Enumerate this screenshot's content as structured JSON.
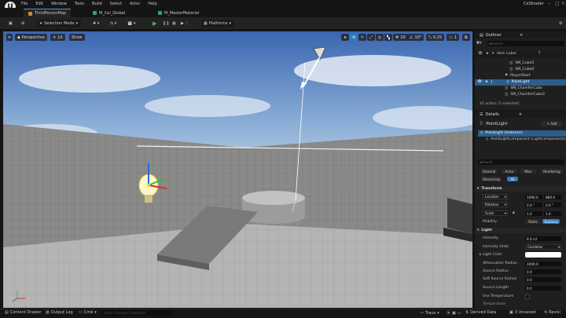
{
  "menu": [
    "File",
    "Edit",
    "Window",
    "Tools",
    "Build",
    "Select",
    "Actor",
    "Help"
  ],
  "project_name": "CelShader",
  "tabs": [
    {
      "label": "ThirdPersonMap",
      "color": "#d08a2a"
    },
    {
      "label": "M_Cel_Global",
      "color": "#3aa35a"
    },
    {
      "label": "M_MasterMaterial",
      "color": "#3aa35a"
    }
  ],
  "toolbar": {
    "mode": "Selection Mode",
    "platforms": "Platforms"
  },
  "viewport": {
    "perspective": "Perspective",
    "lit": "Lit",
    "show": "Show",
    "grid_snap": "10",
    "rot_snap": "10°",
    "scale_snap": "0.25",
    "camera_speed": "1"
  },
  "outliner": {
    "title": "Outliner",
    "search_placeholder": "Search...",
    "col_label": "Item Label",
    "items": [
      {
        "label": "SM_Cube5",
        "selected": false
      },
      {
        "label": "SM_Cube6",
        "selected": false
      },
      {
        "label": "PlayerStart",
        "selected": false
      },
      {
        "label": "PointLight",
        "selected": true
      },
      {
        "label": "SM_ChamferCube",
        "selected": false
      },
      {
        "label": "SM_ChamferCube2",
        "selected": false
      }
    ],
    "status": "42 actors (1 selected)"
  },
  "details": {
    "title": "Details",
    "actor_name": "PointLight",
    "add_label": "+ Add",
    "instance_label": "PointLight (Instance)",
    "component_label": "PointLightComponent (LightComponent0)",
    "search_placeholder": "Search",
    "filters_row1": [
      "General",
      "Actor",
      "Misc",
      "Rendering"
    ],
    "filters_row2": [
      "Streaming",
      "All"
    ],
    "transform_header": "Transform",
    "location_label": "Location",
    "location_x": "1090.0",
    "location_y": "880.0",
    "rotation_label": "Rotation",
    "rotation_x": "0.0 °",
    "rotation_y": "0.0 °",
    "scale_label": "Scale",
    "scale_x": "1.0",
    "scale_y": "1.0",
    "mobility_label": "Mobility",
    "mobility_static": "Static",
    "mobility_stationary": "Stationa",
    "light_header": "Light",
    "intensity_label": "Intensity",
    "intensity_value": "8.0 cd",
    "intensity_units_label": "Intensity Units",
    "intensity_units_value": "Candelas",
    "light_color_label": "Light Color",
    "attenuation_label": "Attenuation Radius",
    "attenuation_value": "1000.0",
    "source_radius_label": "Source Radius",
    "source_radius_value": "0.0",
    "soft_source_label": "Soft Source Radius",
    "soft_source_value": "0.0",
    "source_length_label": "Source Length",
    "source_length_value": "0.0",
    "use_temp_label": "Use Temperature",
    "temperature_label": "Temperature"
  },
  "bottom": {
    "content_drawer": "Content Drawer",
    "output_log": "Output Log",
    "cmd": "Cmd",
    "console_placeholder": "Enter Console Command",
    "trace": "Trace",
    "derived_data": "Derived Data",
    "unsaved": "3 Unsaved",
    "revision": "Revisi"
  }
}
